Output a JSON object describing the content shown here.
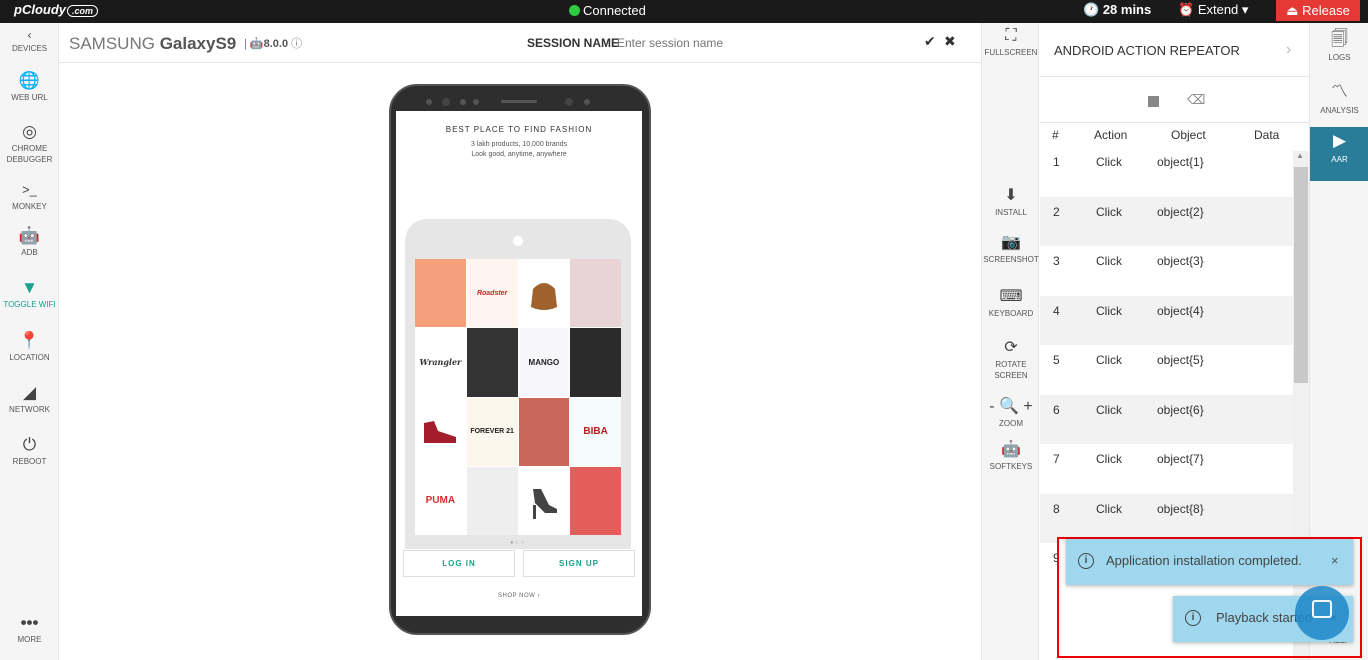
{
  "topbar": {
    "logo": "pCloudy",
    "logo_suffix": ".com",
    "status": "Connected",
    "status_color": "#2ecc40",
    "timer": "28 mins",
    "extend_label": "Extend",
    "release_label": "Release",
    "release_color": "#e53935"
  },
  "left_nav": [
    {
      "icon": "chevron-left-icon",
      "label": "DEVICES"
    },
    {
      "icon": "globe-icon",
      "label": "WEB URL"
    },
    {
      "icon": "chrome-icon",
      "label": "CHROME DEBUGGER"
    },
    {
      "icon": "terminal-icon",
      "label": "MONKEY"
    },
    {
      "icon": "android-icon",
      "label": "ADB"
    },
    {
      "icon": "wifi-icon",
      "label": "TOGGLE WIFI"
    },
    {
      "icon": "location-pin-icon",
      "label": "LOCATION"
    },
    {
      "icon": "signal-icon",
      "label": "NETWORK"
    },
    {
      "icon": "power-icon",
      "label": "REBOOT"
    },
    {
      "icon": "more-icon",
      "label": "MORE"
    }
  ],
  "device": {
    "brand": "SAMSUNG",
    "model": "GalaxyS9",
    "separator": "|",
    "android_version": "8.0.0",
    "session_label": "SESSION NAME",
    "session_placeholder": "Enter session name"
  },
  "phone_screen": {
    "title": "BEST PLACE TO FIND FASHION",
    "subtitle1": "3 lakh products, 10,000 brands",
    "subtitle2": "Look good, anytime, anywhere",
    "tiles": [
      "",
      "Roadster",
      "",
      "",
      "Wrangler",
      "",
      "MANGO",
      "",
      "",
      "FOREVER 21",
      "",
      "BIBA",
      "PUMA",
      "",
      "",
      ""
    ],
    "login_label": "LOG IN",
    "signup_label": "SIGN UP",
    "shop_now": "SHOP NOW ›"
  },
  "toolbar": [
    {
      "icon": "fullscreen-icon",
      "label": "FULLSCREEN"
    },
    {
      "icon": "download-icon",
      "label": "INSTALL"
    },
    {
      "icon": "camera-icon",
      "label": "SCREENSHOT"
    },
    {
      "icon": "keyboard-icon",
      "label": "KEYBOARD"
    },
    {
      "icon": "rotate-icon",
      "label": "ROTATE SCREEN"
    },
    {
      "icon": "zoom-icon",
      "label": "ZOOM"
    },
    {
      "icon": "android-icon",
      "label": "SOFTKEYS"
    }
  ],
  "aar": {
    "title": "ANDROID ACTION REPEATOR",
    "columns": [
      "#",
      "Action",
      "Object",
      "Data"
    ],
    "rows": [
      {
        "num": "1",
        "action": "Click",
        "object": "object{1}",
        "data": ""
      },
      {
        "num": "2",
        "action": "Click",
        "object": "object{2}",
        "data": ""
      },
      {
        "num": "3",
        "action": "Click",
        "object": "object{3}",
        "data": ""
      },
      {
        "num": "4",
        "action": "Click",
        "object": "object{4}",
        "data": ""
      },
      {
        "num": "5",
        "action": "Click",
        "object": "object{5}",
        "data": ""
      },
      {
        "num": "6",
        "action": "Click",
        "object": "object{6}",
        "data": ""
      },
      {
        "num": "7",
        "action": "Click",
        "object": "object{7}",
        "data": ""
      },
      {
        "num": "8",
        "action": "Click",
        "object": "object{8}",
        "data": ""
      },
      {
        "num": "9",
        "action": "",
        "object": "",
        "data": ""
      }
    ]
  },
  "right_nav": [
    {
      "icon": "logs-icon",
      "label": "LOGS"
    },
    {
      "icon": "analysis-icon",
      "label": "ANALYSIS"
    },
    {
      "icon": "aar-icon",
      "label": "AAR"
    }
  ],
  "help_label": "HELP",
  "toasts": [
    {
      "text": "Application installation completed."
    },
    {
      "text": "Playback started"
    }
  ],
  "accent_color": "#1aa08c",
  "active_nav_color": "#2a7d99"
}
